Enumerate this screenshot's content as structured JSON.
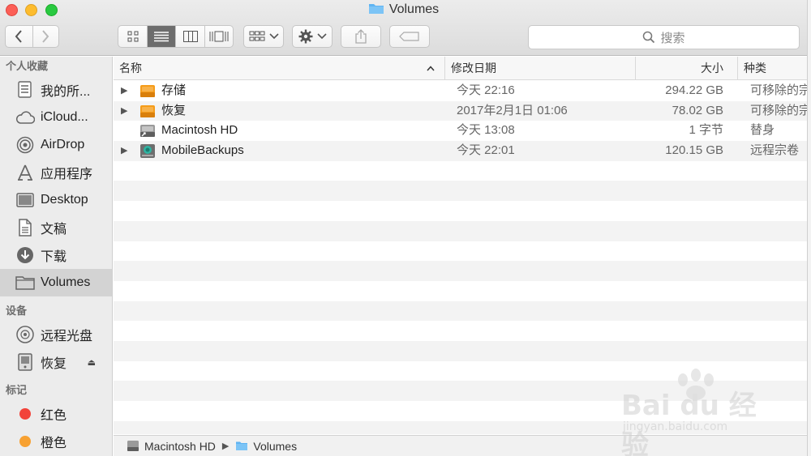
{
  "window": {
    "title": "Volumes"
  },
  "toolbar": {
    "search_placeholder": "搜索"
  },
  "sidebar": {
    "favorites_header": "个人收藏",
    "favorites": [
      {
        "label": "我的所...",
        "icon": "all-files-icon"
      },
      {
        "label": "iCloud...",
        "icon": "cloud-icon"
      },
      {
        "label": "AirDrop",
        "icon": "airdrop-icon"
      },
      {
        "label": "应用程序",
        "icon": "applications-icon"
      },
      {
        "label": "Desktop",
        "icon": "desktop-icon"
      },
      {
        "label": "文稿",
        "icon": "document-icon"
      },
      {
        "label": "下载",
        "icon": "download-icon"
      },
      {
        "label": "Volumes",
        "icon": "folder-icon",
        "selected": true
      }
    ],
    "devices_header": "设备",
    "devices": [
      {
        "label": "远程光盘",
        "icon": "disc-icon"
      },
      {
        "label": "恢复",
        "icon": "drive-icon",
        "ejectable": true
      }
    ],
    "tags_header": "标记",
    "tags": [
      {
        "label": "红色",
        "color": "#f2433a"
      },
      {
        "label": "橙色",
        "color": "#f7a132"
      }
    ]
  },
  "columns": {
    "name": "名称",
    "modified": "修改日期",
    "size": "大小",
    "kind": "种类"
  },
  "files": [
    {
      "name": "存储",
      "modified": "今天 22:16",
      "size": "294.22 GB",
      "kind": "可移除的宗卷",
      "icon": "orange-drive-icon",
      "expandable": true
    },
    {
      "name": "恢复",
      "modified": "2017年2月1日 01:06",
      "size": "78.02 GB",
      "kind": "可移除的宗卷",
      "icon": "orange-drive-icon",
      "expandable": true
    },
    {
      "name": "Macintosh HD",
      "modified": "今天 13:08",
      "size": "1 字节",
      "kind": "替身",
      "icon": "hard-drive-alias-icon",
      "expandable": false
    },
    {
      "name": "MobileBackups",
      "modified": "今天 22:01",
      "size": "120.15 GB",
      "kind": "远程宗卷",
      "icon": "network-drive-icon",
      "expandable": true
    }
  ],
  "pathbar": {
    "items": [
      "Macintosh HD",
      "Volumes"
    ]
  },
  "watermark": {
    "main": "Bai du 经验",
    "sub": "jingyan.baidu.com"
  },
  "colors": {
    "selection": "#d3d3d3",
    "folder_blue": "#5fb4f2",
    "drive_orange": "#f59c1a"
  }
}
